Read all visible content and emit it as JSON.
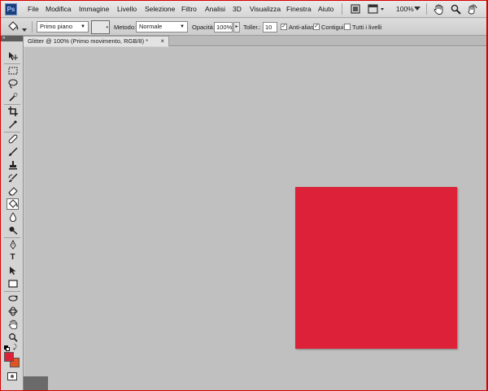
{
  "app": {
    "logo_text": "Ps"
  },
  "menu": {
    "items": [
      "File",
      "Modifica",
      "Immagine",
      "Livello",
      "Selezione",
      "Filtro",
      "Analisi",
      "3D",
      "Visualizza",
      "Finestra",
      "Aiuto"
    ],
    "zoom_level": "100%"
  },
  "options_bar": {
    "fill_source": "Primo piano",
    "mode_label": "Metodo:",
    "mode_value": "Normale",
    "opacity_label": "Opacità:",
    "opacity_value": "100%",
    "tolerance_label": "Toller.:",
    "tolerance_value": "10",
    "anti_alias_label": "Anti-alias",
    "anti_alias_checked": true,
    "contiguous_label": "Contigui",
    "contiguous_checked": true,
    "all_layers_label": "Tutti i livelli",
    "all_layers_checked": false
  },
  "document": {
    "tab_title": "Glitter @ 100% (Primo movimento, RGB/8) *",
    "fill_color": "#dc2139"
  },
  "tools": {
    "header_glyph": "»",
    "active_tool": "paint-bucket",
    "items": [
      "move",
      "marquee",
      "lasso",
      "quick-selection",
      "crop",
      "eyedropper",
      "spot-healing",
      "brush",
      "clone-stamp",
      "history-brush",
      "eraser",
      "paint-bucket",
      "blur",
      "dodge",
      "pen",
      "type",
      "path-selection",
      "shape",
      "3d-rotate",
      "3d-orbit",
      "hand",
      "zoom"
    ],
    "foreground_color": "#dc2139",
    "background_color": "#e0541f",
    "type_glyph": "T"
  }
}
